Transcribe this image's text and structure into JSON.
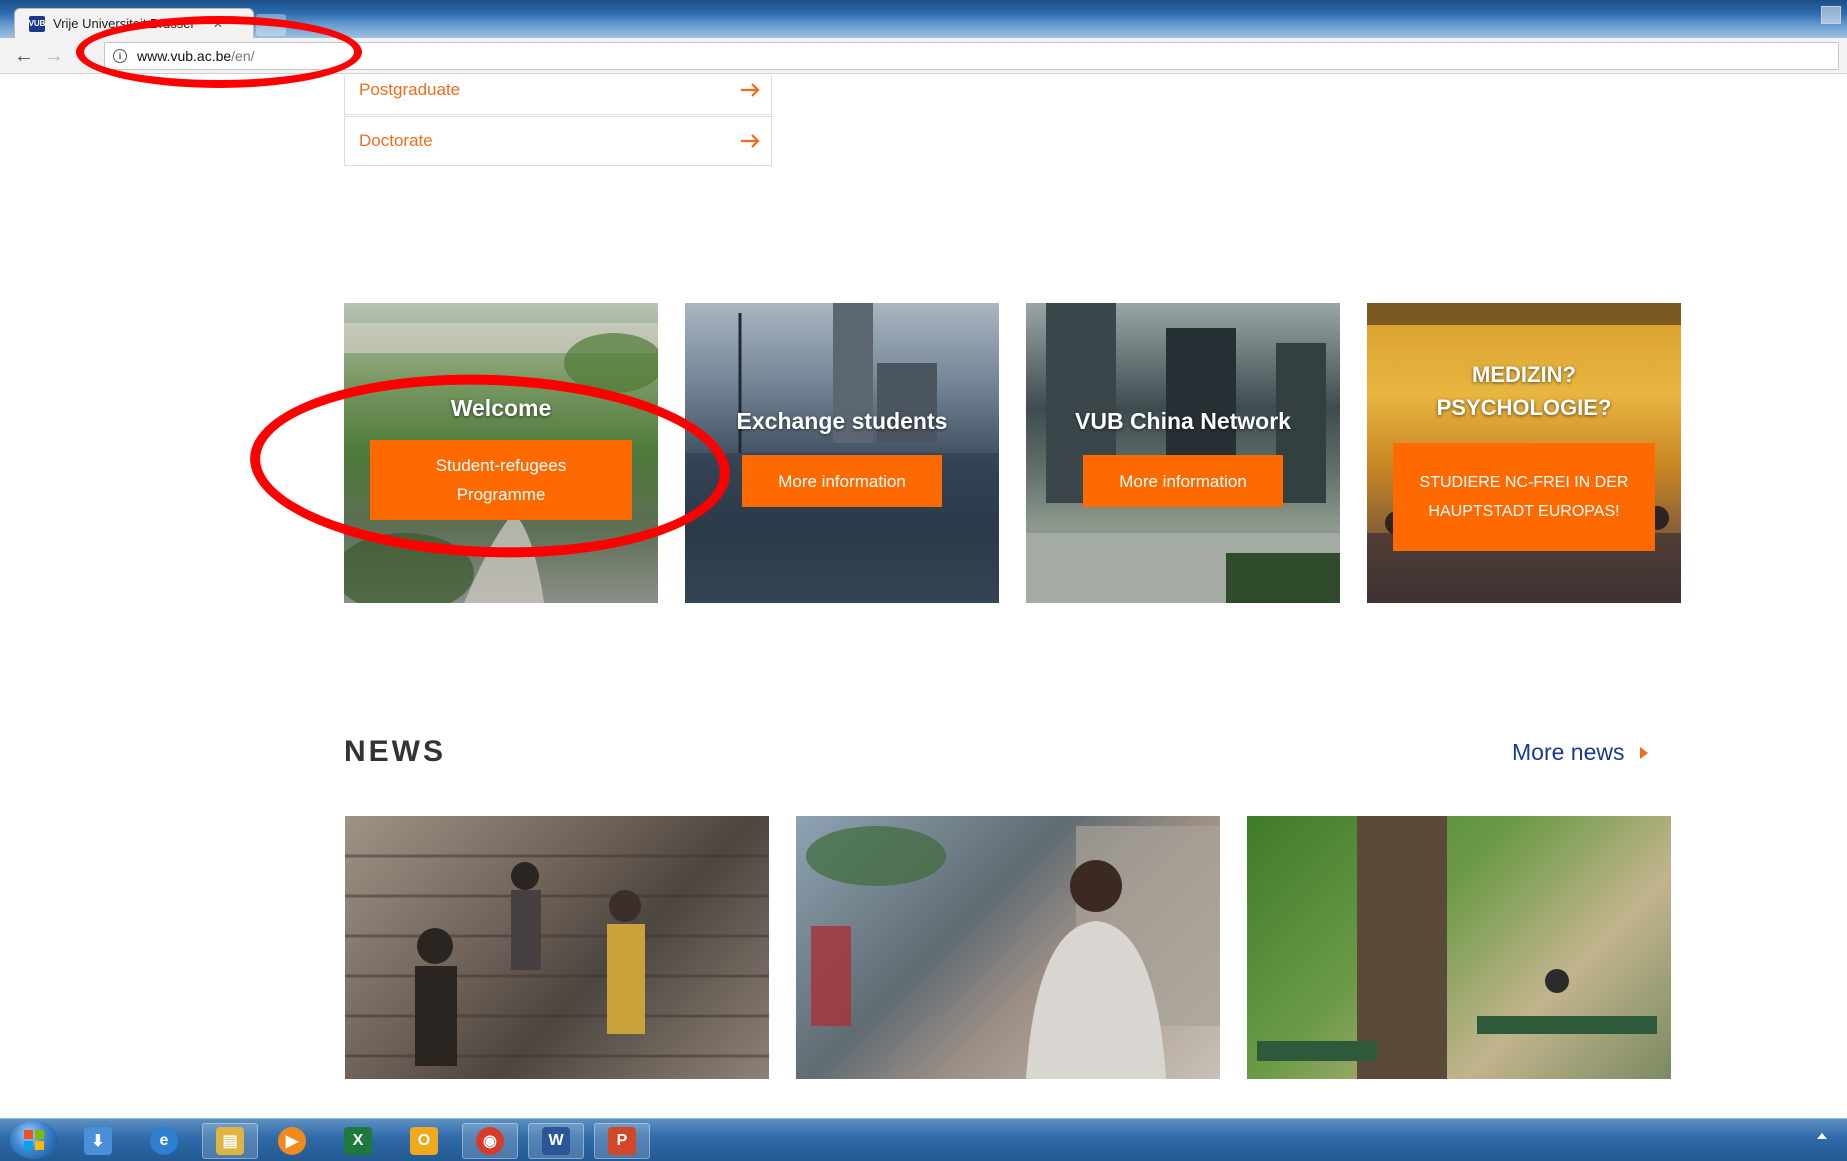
{
  "browser": {
    "tab_title": "Vrije Universiteit Brussel",
    "tab_favicon_text": "VUB",
    "url_domain": "www.vub.ac.be",
    "url_path": "/en/"
  },
  "study_levels": [
    {
      "label": "Postgraduate",
      "arrow": "→"
    },
    {
      "label": "Doctorate",
      "arrow": "→"
    }
  ],
  "tiles": [
    {
      "title": "Welcome",
      "button": "Student-refugees Programme"
    },
    {
      "title": "Exchange students",
      "button": "More information"
    },
    {
      "title": "VUB China Network",
      "button": "More information"
    },
    {
      "title": "MEDIZIN? PSYCHOLOGIE?",
      "button": "STUDIERE NC-FREI IN DER HAUPTSTADT EUROPAS!"
    }
  ],
  "news": {
    "heading": "NEWS",
    "more_label": "More news",
    "cards": [
      {
        "icon": "crowd-on-stairs-photo"
      },
      {
        "icon": "man-in-square-photo"
      },
      {
        "icon": "park-with-tree-photo"
      }
    ]
  },
  "annotation_color": "#ff0000",
  "accent_color": "#f26b1d",
  "taskbar": {
    "icons": [
      {
        "name": "explorer-icon",
        "glyph": "⬇"
      },
      {
        "name": "internet-explorer-icon",
        "glyph": "e"
      },
      {
        "name": "file-manager-icon",
        "glyph": "▤"
      },
      {
        "name": "media-player-icon",
        "glyph": "▶"
      },
      {
        "name": "excel-icon",
        "glyph": "X"
      },
      {
        "name": "outlook-icon",
        "glyph": "O"
      },
      {
        "name": "chrome-icon",
        "glyph": "◉"
      },
      {
        "name": "word-icon",
        "glyph": "W"
      },
      {
        "name": "powerpoint-icon",
        "glyph": "P"
      }
    ]
  }
}
